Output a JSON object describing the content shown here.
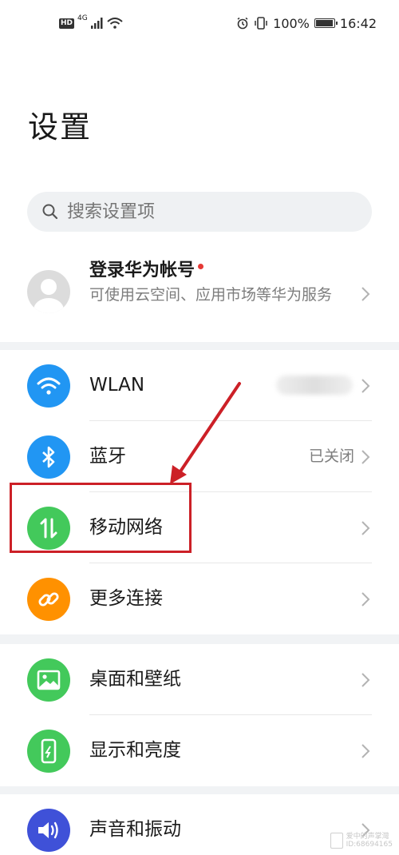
{
  "status_bar": {
    "hd": "HD",
    "network": "4G",
    "battery": "100%",
    "battery_level": 1.0,
    "time": "16:42"
  },
  "title": "设置",
  "search": {
    "placeholder": "搜索设置项"
  },
  "account": {
    "name": "登录华为帐号",
    "description": "可使用云空间、应用市场等华为服务"
  },
  "groups": [
    [
      {
        "label": "WLAN",
        "icon": "wifi-icon",
        "color": "#2196f3"
      },
      {
        "label": "蓝牙",
        "value": "已关闭",
        "icon": "bluetooth-icon",
        "color": "#2196f3"
      },
      {
        "label": "移动网络",
        "icon": "mobile-data-icon",
        "color": "#43c95b"
      },
      {
        "label": "更多连接",
        "icon": "link-icon",
        "color": "#ff9100"
      }
    ],
    [
      {
        "label": "桌面和壁纸",
        "icon": "image-icon",
        "color": "#43c95b"
      },
      {
        "label": "显示和亮度",
        "icon": "phone-display-icon",
        "color": "#43c95b"
      }
    ],
    [
      {
        "label": "声音和振动",
        "icon": "speaker-icon",
        "color": "#3f51d8"
      }
    ]
  ],
  "annotation_color": "#cc2027",
  "watermark": {
    "line1": "爱中的声掌灣",
    "line2": "ID:68694165"
  }
}
